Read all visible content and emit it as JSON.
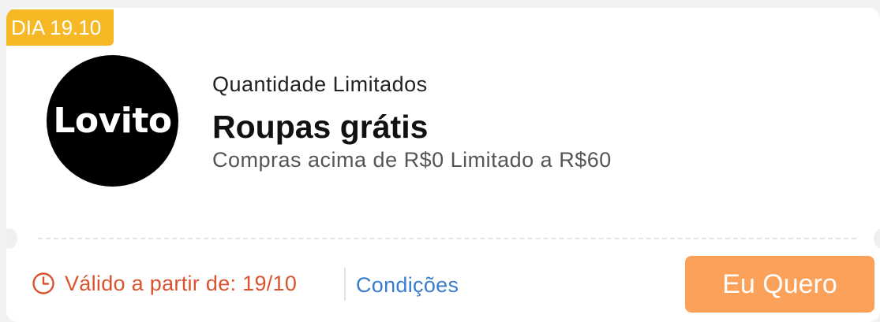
{
  "badge": {
    "date_label": "DIA 19.10"
  },
  "logo": {
    "text": "Lovito"
  },
  "offer": {
    "quantity_label": "Quantidade Limitados",
    "title": "Roupas grátis",
    "subtitle": "Compras acima de R$0 Limitado a R$60"
  },
  "footer": {
    "clock_icon": "clock-icon",
    "valid_from": "Válido a partir de: 19/10",
    "conditions_label": "Condições",
    "cta_label": "Eu Quero"
  },
  "colors": {
    "badge": "#f6b824",
    "valid_text": "#d9532f",
    "link": "#3a7dd0",
    "cta": "#fba15a"
  }
}
